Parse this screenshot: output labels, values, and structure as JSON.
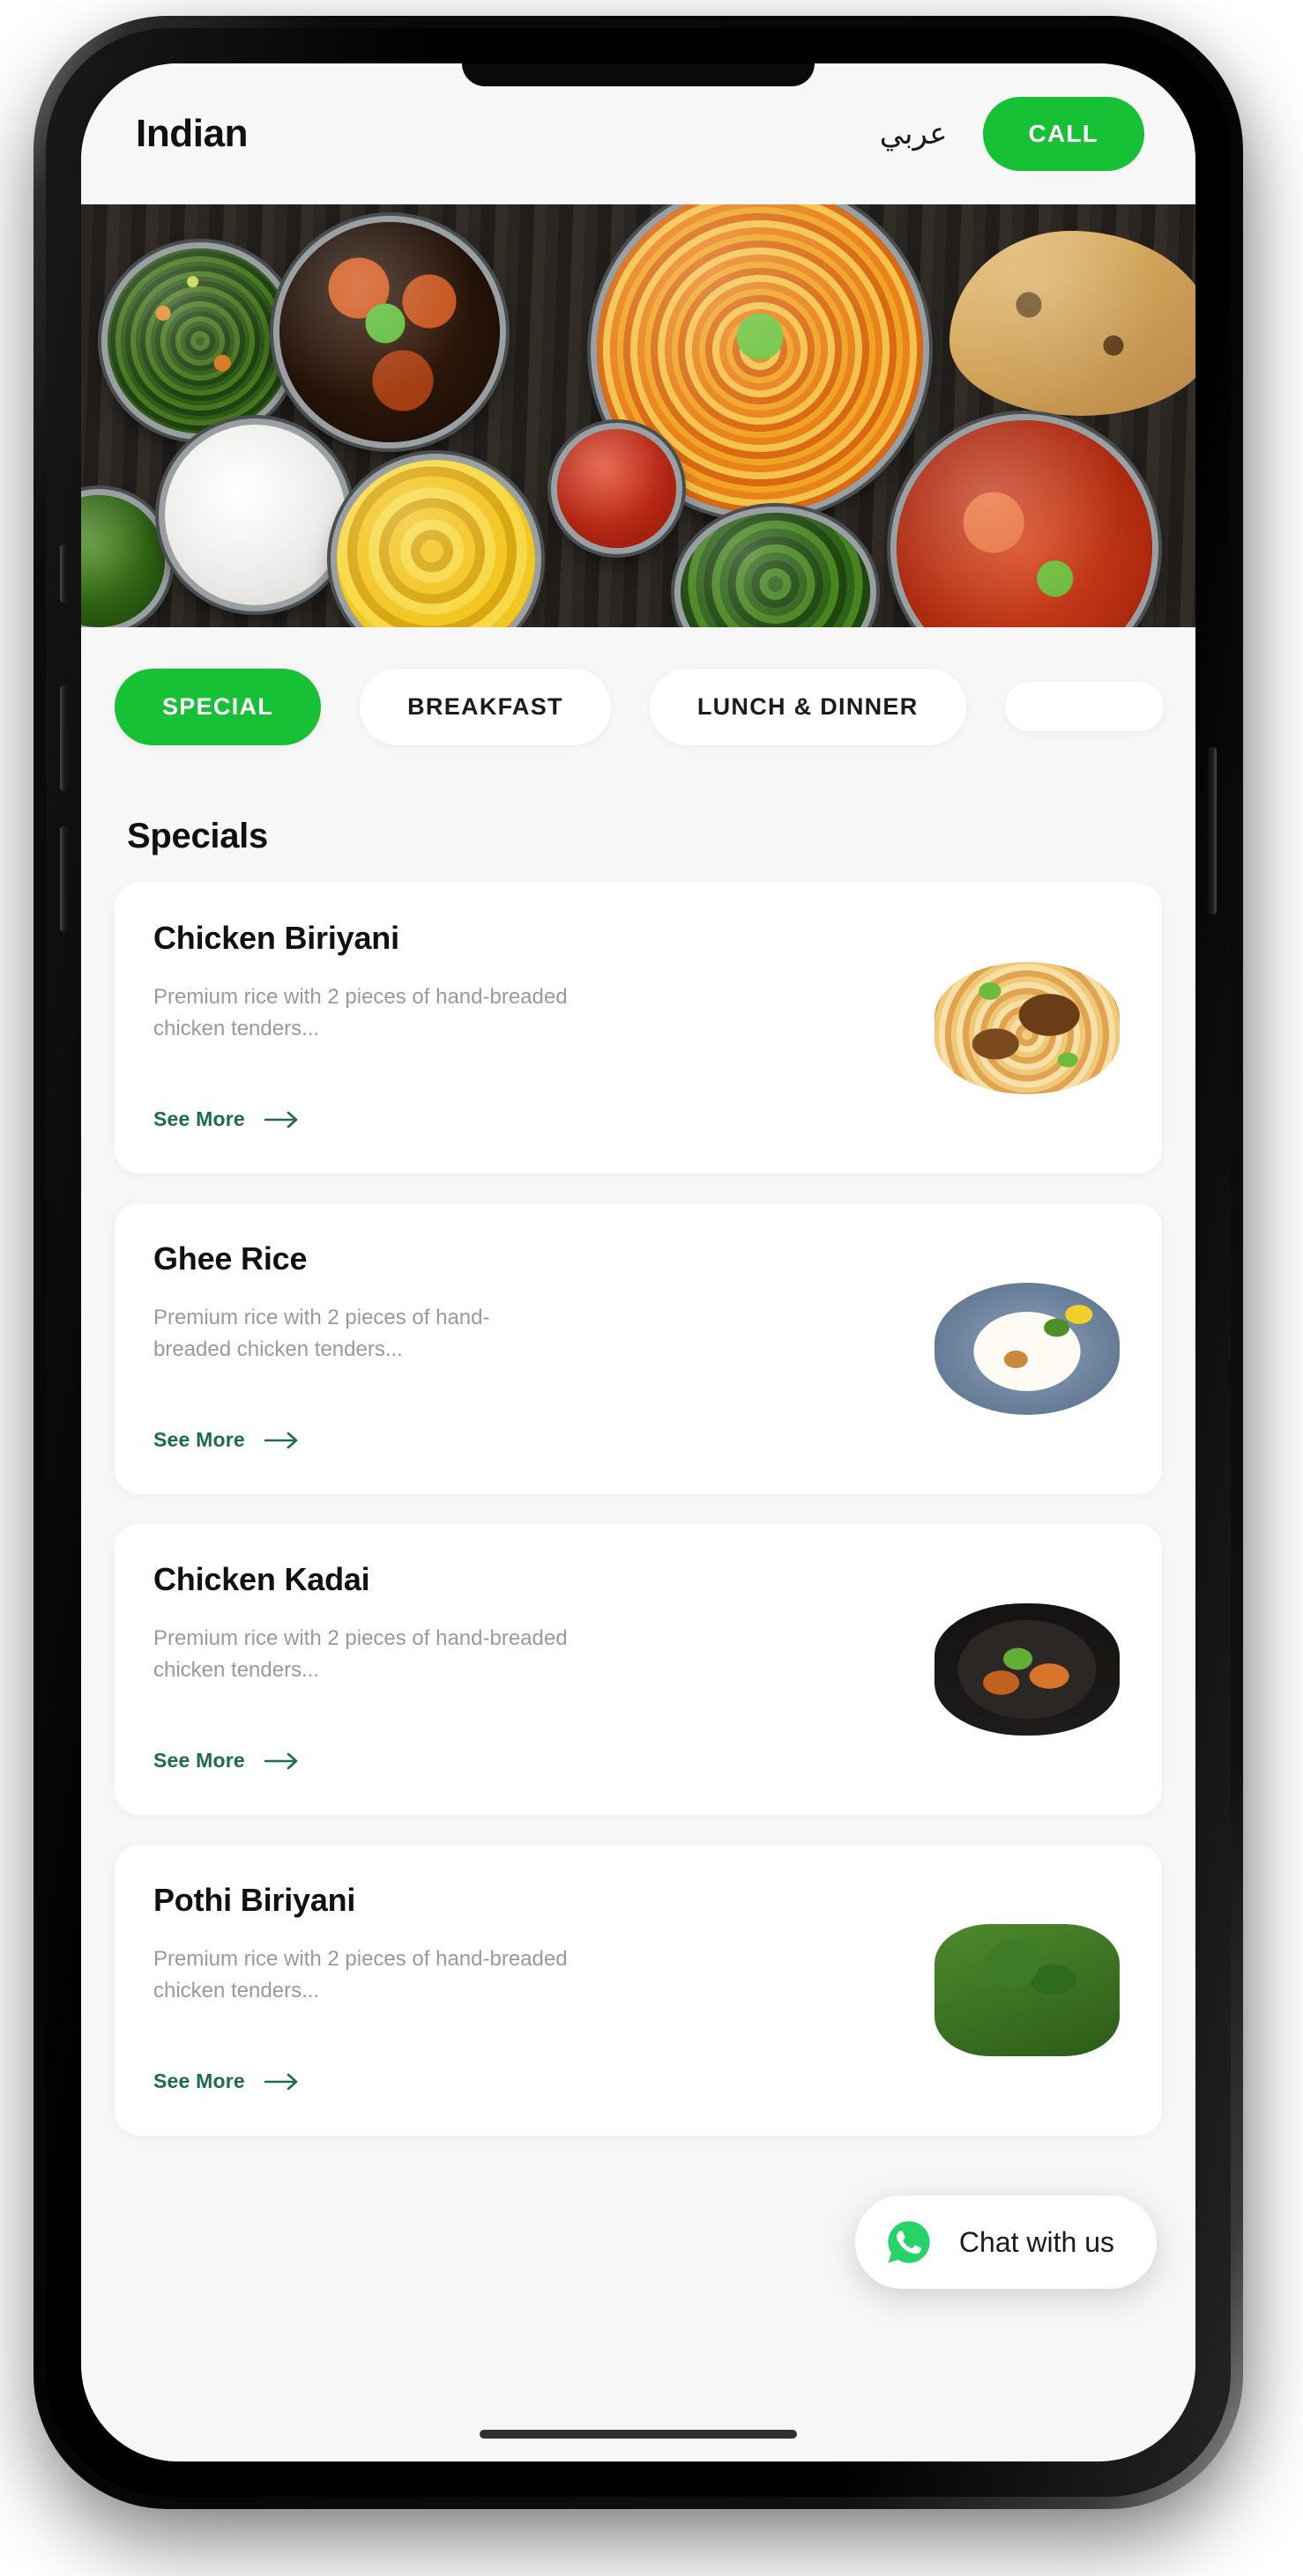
{
  "app": {
    "title": "Indian",
    "language_toggle": "عربي",
    "call_button": "CALL"
  },
  "hero": {
    "alt": "indian-food-spread-photo"
  },
  "tabs": [
    {
      "label": "SPECIAL",
      "active": true
    },
    {
      "label": "BREAKFAST",
      "active": false
    },
    {
      "label": "LUNCH & DINNER",
      "active": false
    },
    {
      "label": "",
      "active": false
    }
  ],
  "section": {
    "title": "Specials"
  },
  "cards": [
    {
      "title": "Chicken Biriyani",
      "description": "Premium rice with 2 pieces of hand-breaded chicken tenders...",
      "link_label": "See More",
      "thumb": "chicken-biriyani-photo"
    },
    {
      "title": "Ghee Rice",
      "description": "Premium rice with 2 pieces of hand-breaded chicken tenders...",
      "link_label": "See More",
      "thumb": "ghee-rice-photo"
    },
    {
      "title": "Chicken Kadai",
      "description": "Premium rice with 2 pieces of hand-breaded chicken tenders...",
      "link_label": "See More",
      "thumb": "chicken-kadai-photo"
    },
    {
      "title": "Pothi Biriyani",
      "description": "Premium rice with 2 pieces of hand-breaded chicken tenders...",
      "link_label": "See More",
      "thumb": "pothi-biriyani-photo"
    }
  ],
  "whatsapp": {
    "label": "Chat with us"
  },
  "colors": {
    "brand_green": "#16c136",
    "whatsapp_green": "#25d366",
    "link_green": "#1d6b52",
    "screen_bg": "#f7f7f7",
    "card_bg": "#ffffff",
    "text_primary": "#111111",
    "text_muted": "#9a9a9a"
  }
}
